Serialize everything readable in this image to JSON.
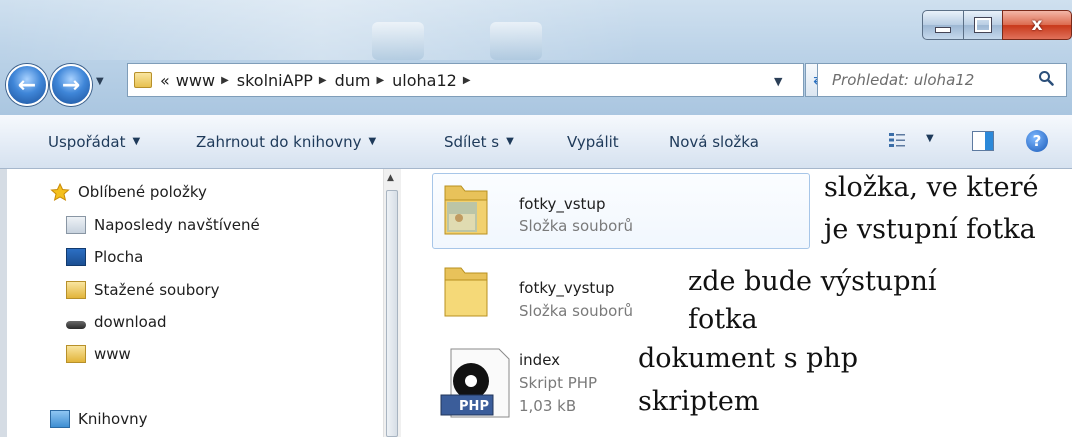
{
  "window": {
    "close_glyph": "x"
  },
  "address": {
    "overflow": "«",
    "crumbs": [
      "www",
      "skolniAPP",
      "dum",
      "uloha12"
    ]
  },
  "search": {
    "placeholder": "Prohledat: uloha12"
  },
  "toolbar": {
    "organize": "Uspořádat",
    "include_library": "Zahrnout do knihovny",
    "share": "Sdílet s",
    "burn": "Vypálit",
    "new_folder": "Nová složka",
    "help": "?"
  },
  "nav": {
    "favorites": "Oblíbené položky",
    "recent": "Naposledy navštívené",
    "desktop": "Plocha",
    "downloads": "Stažené soubory",
    "download": "download",
    "www": "www",
    "libraries": "Knihovny"
  },
  "files": [
    {
      "name": "fotky_vstup",
      "type": "Složka souborů"
    },
    {
      "name": "fotky_vystup",
      "type": "Složka souborů"
    },
    {
      "name": "index",
      "type": "Skript PHP",
      "size": "1,03 kB",
      "badge": "PHP"
    }
  ],
  "annotations": {
    "a1_line1": "složka, ve které",
    "a1_line2": "je vstupní fotka",
    "a2_line1": "zde bude výstupní",
    "a2_line2": "fotka",
    "a3_line1": "dokument s php",
    "a3_line2": "skriptem"
  },
  "colors": {
    "toolbar_text": "#1e3a5a",
    "secondary_text": "#7a7a7a",
    "selection_border": "#a7c6e8",
    "close_red": "#c8381a"
  }
}
